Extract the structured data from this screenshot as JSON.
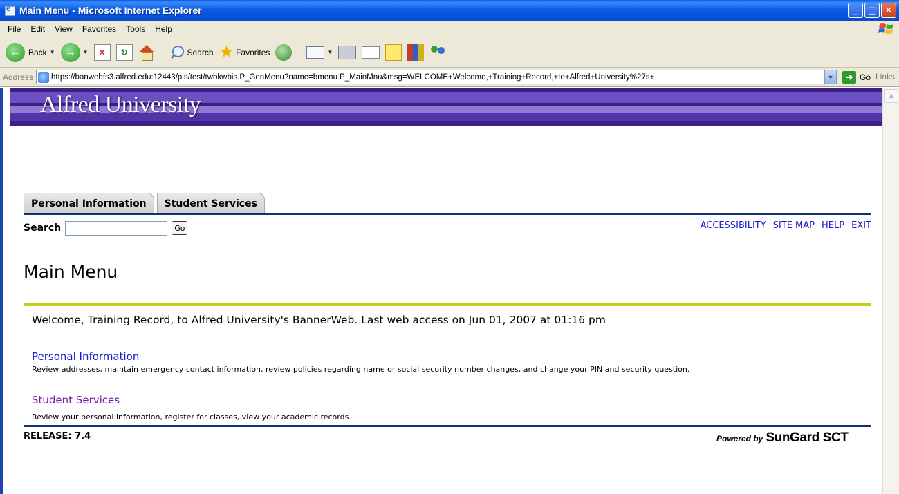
{
  "window": {
    "title": "Main Menu - Microsoft Internet Explorer",
    "controls": {
      "minimize": "_",
      "maximize": "□",
      "close": "✕"
    }
  },
  "menubar": {
    "items": [
      "File",
      "Edit",
      "View",
      "Favorites",
      "Tools",
      "Help"
    ]
  },
  "toolbar": {
    "back_label": "Back",
    "search_label": "Search",
    "favorites_label": "Favorites"
  },
  "addressbar": {
    "label": "Address",
    "url": "https://banwebfs3.alfred.edu:12443/pls/test/twbkwbis.P_GenMenu?name=bmenu.P_MainMnu&msg=WELCOME+Welcome,+Training+Record,+to+Alfred+University%27s+",
    "go_label": "Go",
    "links_label": "Links"
  },
  "banner": {
    "title": "Alfred University"
  },
  "tabs": [
    "Personal Information",
    "Student Services"
  ],
  "search": {
    "label": "Search",
    "value": "",
    "go_label": "Go"
  },
  "util_links": [
    "ACCESSIBILITY",
    "SITE MAP",
    "HELP",
    "EXIT"
  ],
  "page": {
    "title": "Main Menu",
    "welcome": "Welcome, Training Record, to Alfred University's BannerWeb. Last web access on Jun 01, 2007 at 01:16 pm"
  },
  "menu": [
    {
      "label": "Personal Information",
      "description": "Review addresses, maintain emergency contact information, review policies regarding name or social security number changes, and change your PIN and security question."
    },
    {
      "label": "Student Services",
      "description": "Review your personal information, register for classes, view your academic records."
    }
  ],
  "footer": {
    "release": "RELEASE: 7.4",
    "powered_by": "Powered by",
    "brand": "SunGard SCT"
  },
  "colors": {
    "banner_purple": "#4a2c8f",
    "rule_navy": "#10356b",
    "rule_olive": "#c7cc22",
    "link_blue": "#1a1acc",
    "link_visited": "#7a1aa8"
  }
}
